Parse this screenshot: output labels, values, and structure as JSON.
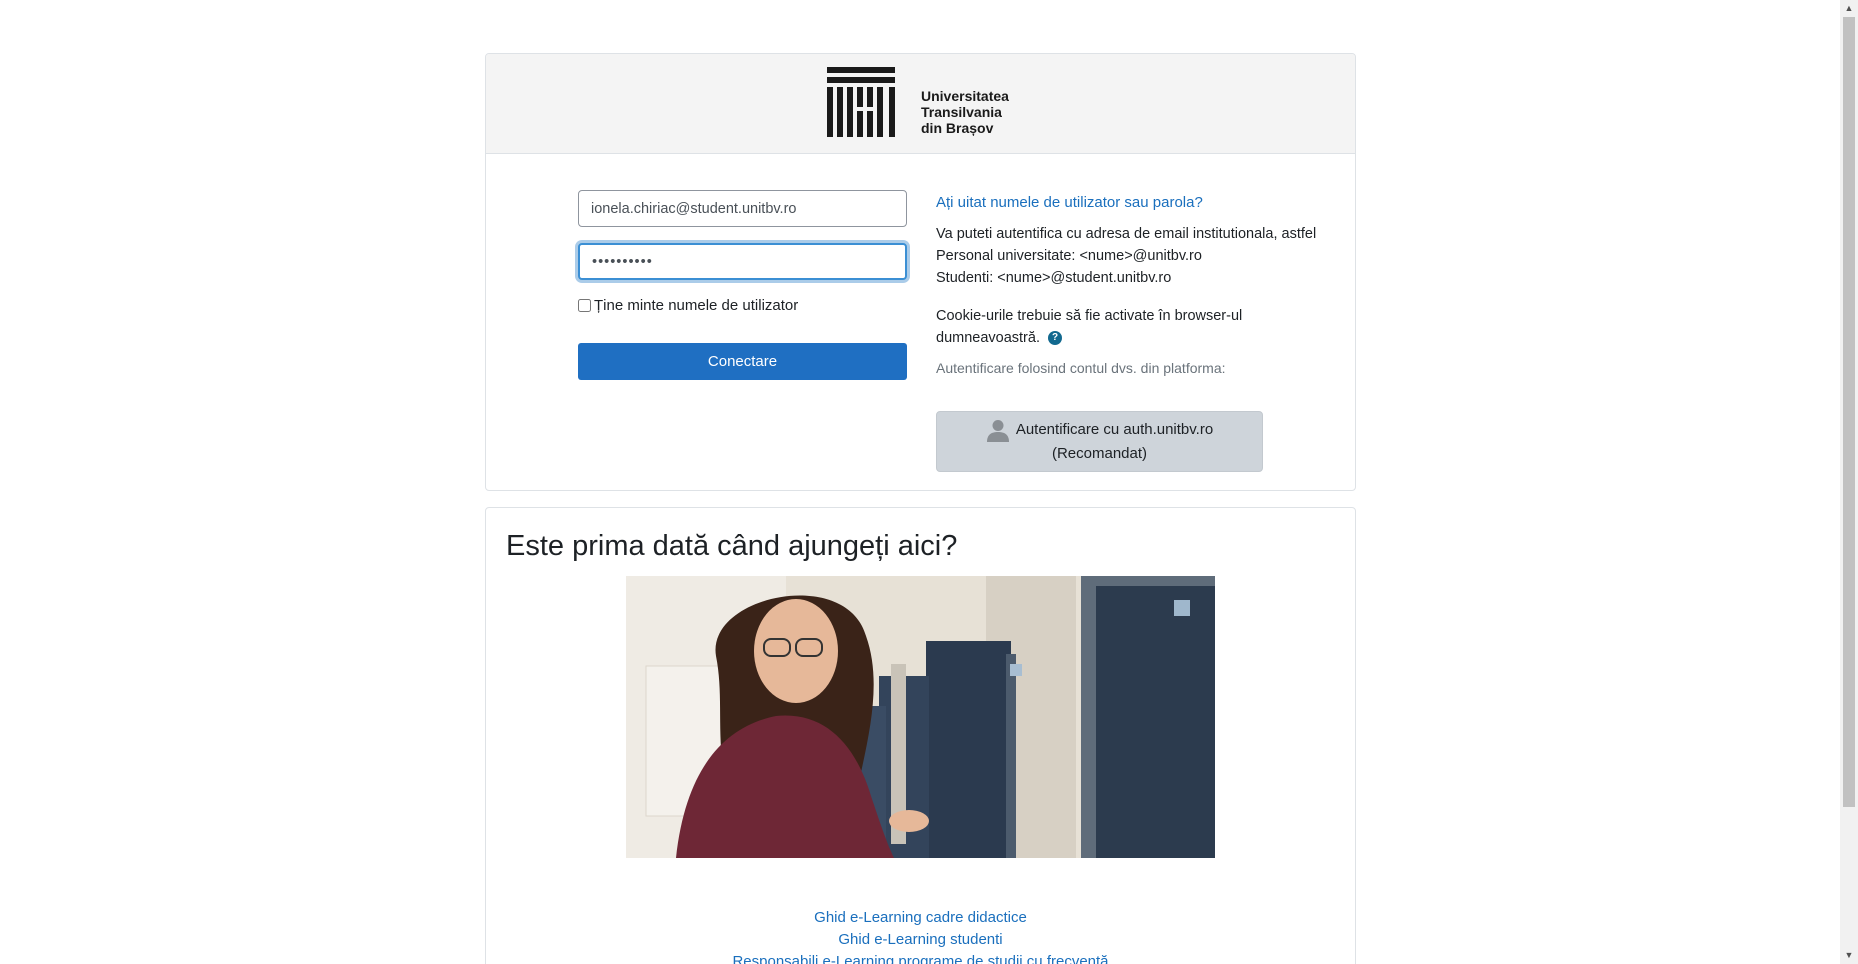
{
  "header": {
    "logo_name": "university-logo",
    "logo_lines": [
      "Universitatea",
      "Transilvania",
      "din Brașov"
    ]
  },
  "login": {
    "username_value": "ionela.chiriac@student.unitbv.ro",
    "password_value": "••••••••••",
    "remember_label": "Ține minte numele de utilizator",
    "login_button_label": "Conectare"
  },
  "info": {
    "forgot_link": "Ați uitat numele de utilizator sau parola?",
    "auth_lines": [
      "Va puteti autentifica cu adresa de email institutionala, astfel",
      "Personal universitate: <nume>@unitbv.ro",
      "Studenti: <nume>@student.unitbv.ro"
    ],
    "cookie_line1": "Cookie-urile trebuie să fie activate în browser-ul",
    "cookie_line2": "dumneavoastră.",
    "help_glyph": "?",
    "platform_label": "Autentificare folosind contul dvs. din platforma:",
    "auth_button_line1": "Autentificare cu auth.unitbv.ro",
    "auth_button_line2": "(Recomandat)"
  },
  "first_time": {
    "title": "Este prima dată când ajungeți aici?",
    "links": [
      "Ghid e-Learning cadre didactice",
      "Ghid e-Learning studenti",
      "Responsabili e-Learning programe de studii cu frecventă"
    ]
  },
  "colors": {
    "accent": "#1f6fc2",
    "link": "#1a6fbd",
    "header_bg": "#f4f4f4",
    "auth_button_bg": "#ced4da"
  }
}
